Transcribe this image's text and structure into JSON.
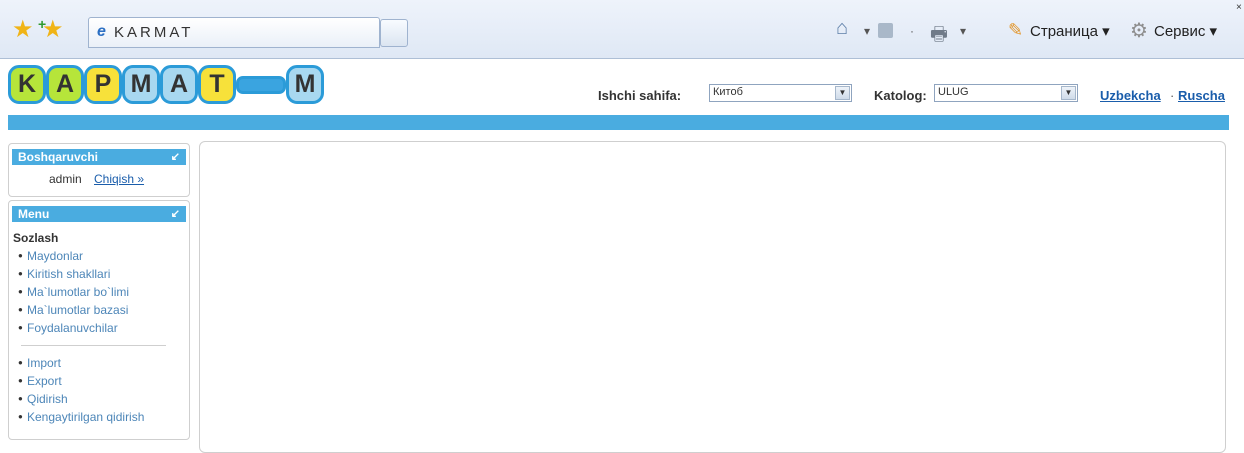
{
  "browser": {
    "tab_title": "KARMAT",
    "page_menu": "Страница ▾",
    "tools_menu": "Сервис ▾"
  },
  "logo": {
    "letters": [
      "K",
      "A",
      "P",
      "M",
      "A",
      "T",
      "",
      "M"
    ]
  },
  "header": {
    "work_page_label": "Ishchi sahifa:",
    "work_page_value": "Китоб",
    "catalog_label": "Katolog:",
    "catalog_value": "ULUG",
    "lang_uz": "Uzbekcha",
    "lang_sep": "·",
    "lang_ru": "Ruscha"
  },
  "admin_box": {
    "title": "Boshqaruvchi",
    "user": "admin",
    "logout": "Chiqish »"
  },
  "menu_box": {
    "title": "Menu",
    "section": "Sozlash",
    "items": [
      "Maydonlar",
      "Kiritish shakllari",
      "Ma`lumotlar bo`limi",
      "Ma`lumotlar bazasi",
      "Foydalanuvchilar"
    ],
    "items2": [
      "Import",
      "Export",
      "Qidirish",
      "Kengaytirilgan qidirish"
    ]
  },
  "colors": {
    "accent": "#4aace0",
    "link": "#1a5dab",
    "tile_border": "#2b9bd8"
  }
}
